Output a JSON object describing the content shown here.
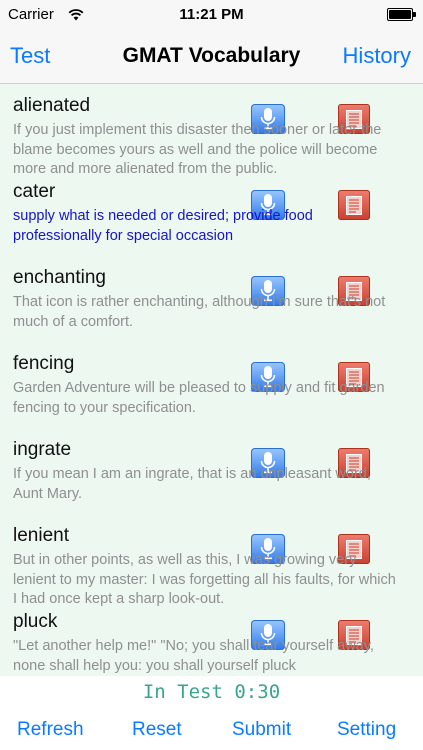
{
  "status_bar": {
    "carrier": "Carrier",
    "time": "11:21 PM"
  },
  "nav": {
    "left": "Test",
    "title": "GMAT Vocabulary",
    "right": "History"
  },
  "words": [
    {
      "word": "alienated",
      "definition": "If you just implement this disaster then sooner or later the blame becomes yours as well and the police will become more and more alienated from the public."
    },
    {
      "word": "cater",
      "definition": "supply what is needed or desired; provide food professionally for special occasion"
    },
    {
      "word": "enchanting",
      "definition": "That icon is rather enchanting, although I'm sure that's not much of a comfort."
    },
    {
      "word": "fencing",
      "definition": "Garden Adventure will be pleased to supply and fit garden fencing to your specification."
    },
    {
      "word": "ingrate",
      "definition": "If you mean I am an ingrate, that is an unpleasant word, Aunt Mary."
    },
    {
      "word": "lenient",
      "definition": "But in other points, as well as this, I was growing very lenient to my master: I was forgetting all his faults, for which I had once kept a sharp look-out."
    },
    {
      "word": "pluck",
      "definition": "\"Let another help me!\" \"No; you shall tear yourself away, none shall help you: you shall yourself pluck"
    }
  ],
  "test_status": "In Test 0:30",
  "toolbar": {
    "refresh": "Refresh",
    "reset": "Reset",
    "submit": "Submit",
    "setting": "Setting"
  },
  "colors": {
    "accent": "#0a7bff",
    "list_background": "#edf8f1",
    "definition_highlight": "#1515c8",
    "test_status": "#3aa58d"
  },
  "icons": {
    "microphone": "microphone-icon",
    "notes": "note-icon",
    "wifi": "wifi-icon",
    "battery": "battery-icon"
  }
}
